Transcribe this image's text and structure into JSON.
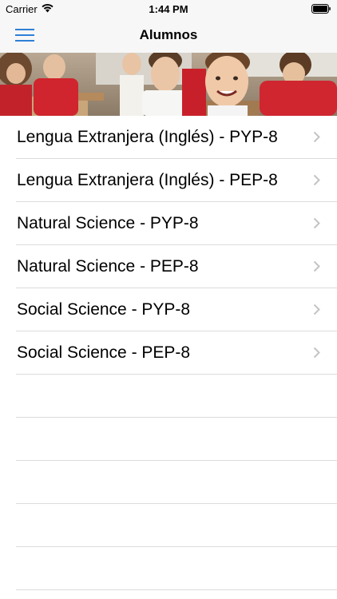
{
  "status": {
    "carrier": "Carrier",
    "time": "1:44 PM"
  },
  "nav": {
    "title": "Alumnos",
    "menu_icon": "hamburger-menu-icon"
  },
  "colors": {
    "accent": "#2f7fd6",
    "separator": "#dcdcdc",
    "chevron": "#c4c4c6"
  },
  "subjects": [
    {
      "label": "Lengua Extranjera (Inglés) - PYP-8"
    },
    {
      "label": "Lengua Extranjera (Inglés) - PEP-8"
    },
    {
      "label": "Natural Science - PYP-8"
    },
    {
      "label": "Natural Science - PEP-8"
    },
    {
      "label": "Social Science - PYP-8"
    },
    {
      "label": "Social Science - PEP-8"
    }
  ]
}
